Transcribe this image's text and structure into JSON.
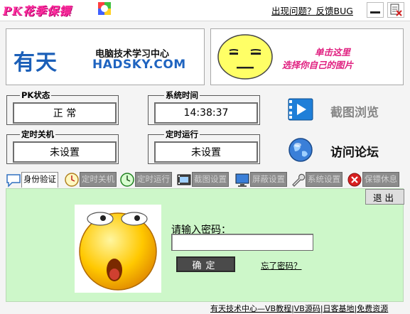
{
  "window": {
    "app_title": "PK花季保镖",
    "feedback_link": "出现问题？反馈BUG"
  },
  "banner_site": {
    "logo": "有天",
    "title": "电脑技术学习中心",
    "domain": "HADSKY.COM"
  },
  "banner_custom": {
    "line1": "单击这里",
    "line2": "选择你自己的图片"
  },
  "status": {
    "pk_caption": "PK状态",
    "pk_value": "正 常",
    "time_caption": "系统时间",
    "time_value": "14:38:37",
    "shutdown_caption": "定时关机",
    "shutdown_value": "未设置",
    "run_caption": "定时运行",
    "run_value": "未设置"
  },
  "actions": {
    "screenshot_label": "截图浏览",
    "forum_label": "访问论坛"
  },
  "tabs": [
    {
      "label": "身份验证",
      "icon": "chat-bubble-icon",
      "active": true
    },
    {
      "label": "定时关机",
      "icon": "clock-icon",
      "active": false
    },
    {
      "label": "定时运行",
      "icon": "run-clock-icon",
      "active": false
    },
    {
      "label": "截图设置",
      "icon": "film-icon",
      "active": false
    },
    {
      "label": "屏蔽设置",
      "icon": "monitor-icon",
      "active": false
    },
    {
      "label": "系统设置",
      "icon": "wrench-icon",
      "active": false
    },
    {
      "label": "保镖休息",
      "icon": "stop-icon",
      "active": false
    }
  ],
  "auth": {
    "exit_label": "退出",
    "prompt": "请输入密码：",
    "password_value": "",
    "ok_label": "确定",
    "forgot_label": "忘了密码？"
  },
  "footer": {
    "text": "有天技术中心—VB教程|VB源码|日客基地|免费资源"
  },
  "colors": {
    "panel_bg": "#cdf7c9",
    "logo_pink": "#ff2fa0",
    "site_blue": "#1b5fb8",
    "custom_text": "#e02080"
  }
}
